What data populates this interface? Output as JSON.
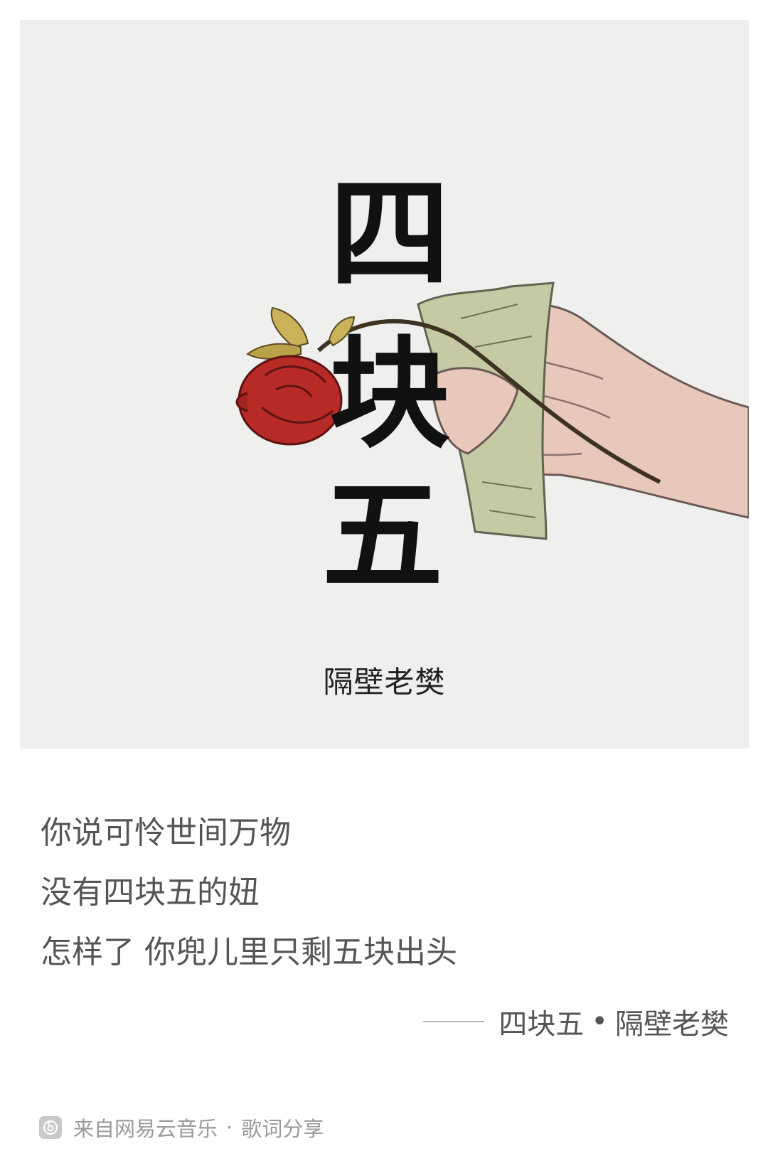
{
  "album": {
    "title_calligraphy": "四块五",
    "artist": "隔壁老樊"
  },
  "lyrics": [
    "你说可怜世间万物",
    "没有四块五的妞",
    "怎样了 你兜儿里只剩五块出头"
  ],
  "credit": {
    "song": "四块五",
    "separator": "•",
    "artist": "隔壁老樊"
  },
  "footer": {
    "source": "来自网易云音乐",
    "separator": "·",
    "feature": "歌词分享",
    "logo_icon": "netease-cloud-music-icon"
  },
  "colors": {
    "card_bg": "#efefee",
    "lyric_text": "#555555",
    "footer_text": "#9a9a9a",
    "rose_red": "#b72a26",
    "skin": "#e7c8ba",
    "money_green": "#c5c9a4"
  }
}
